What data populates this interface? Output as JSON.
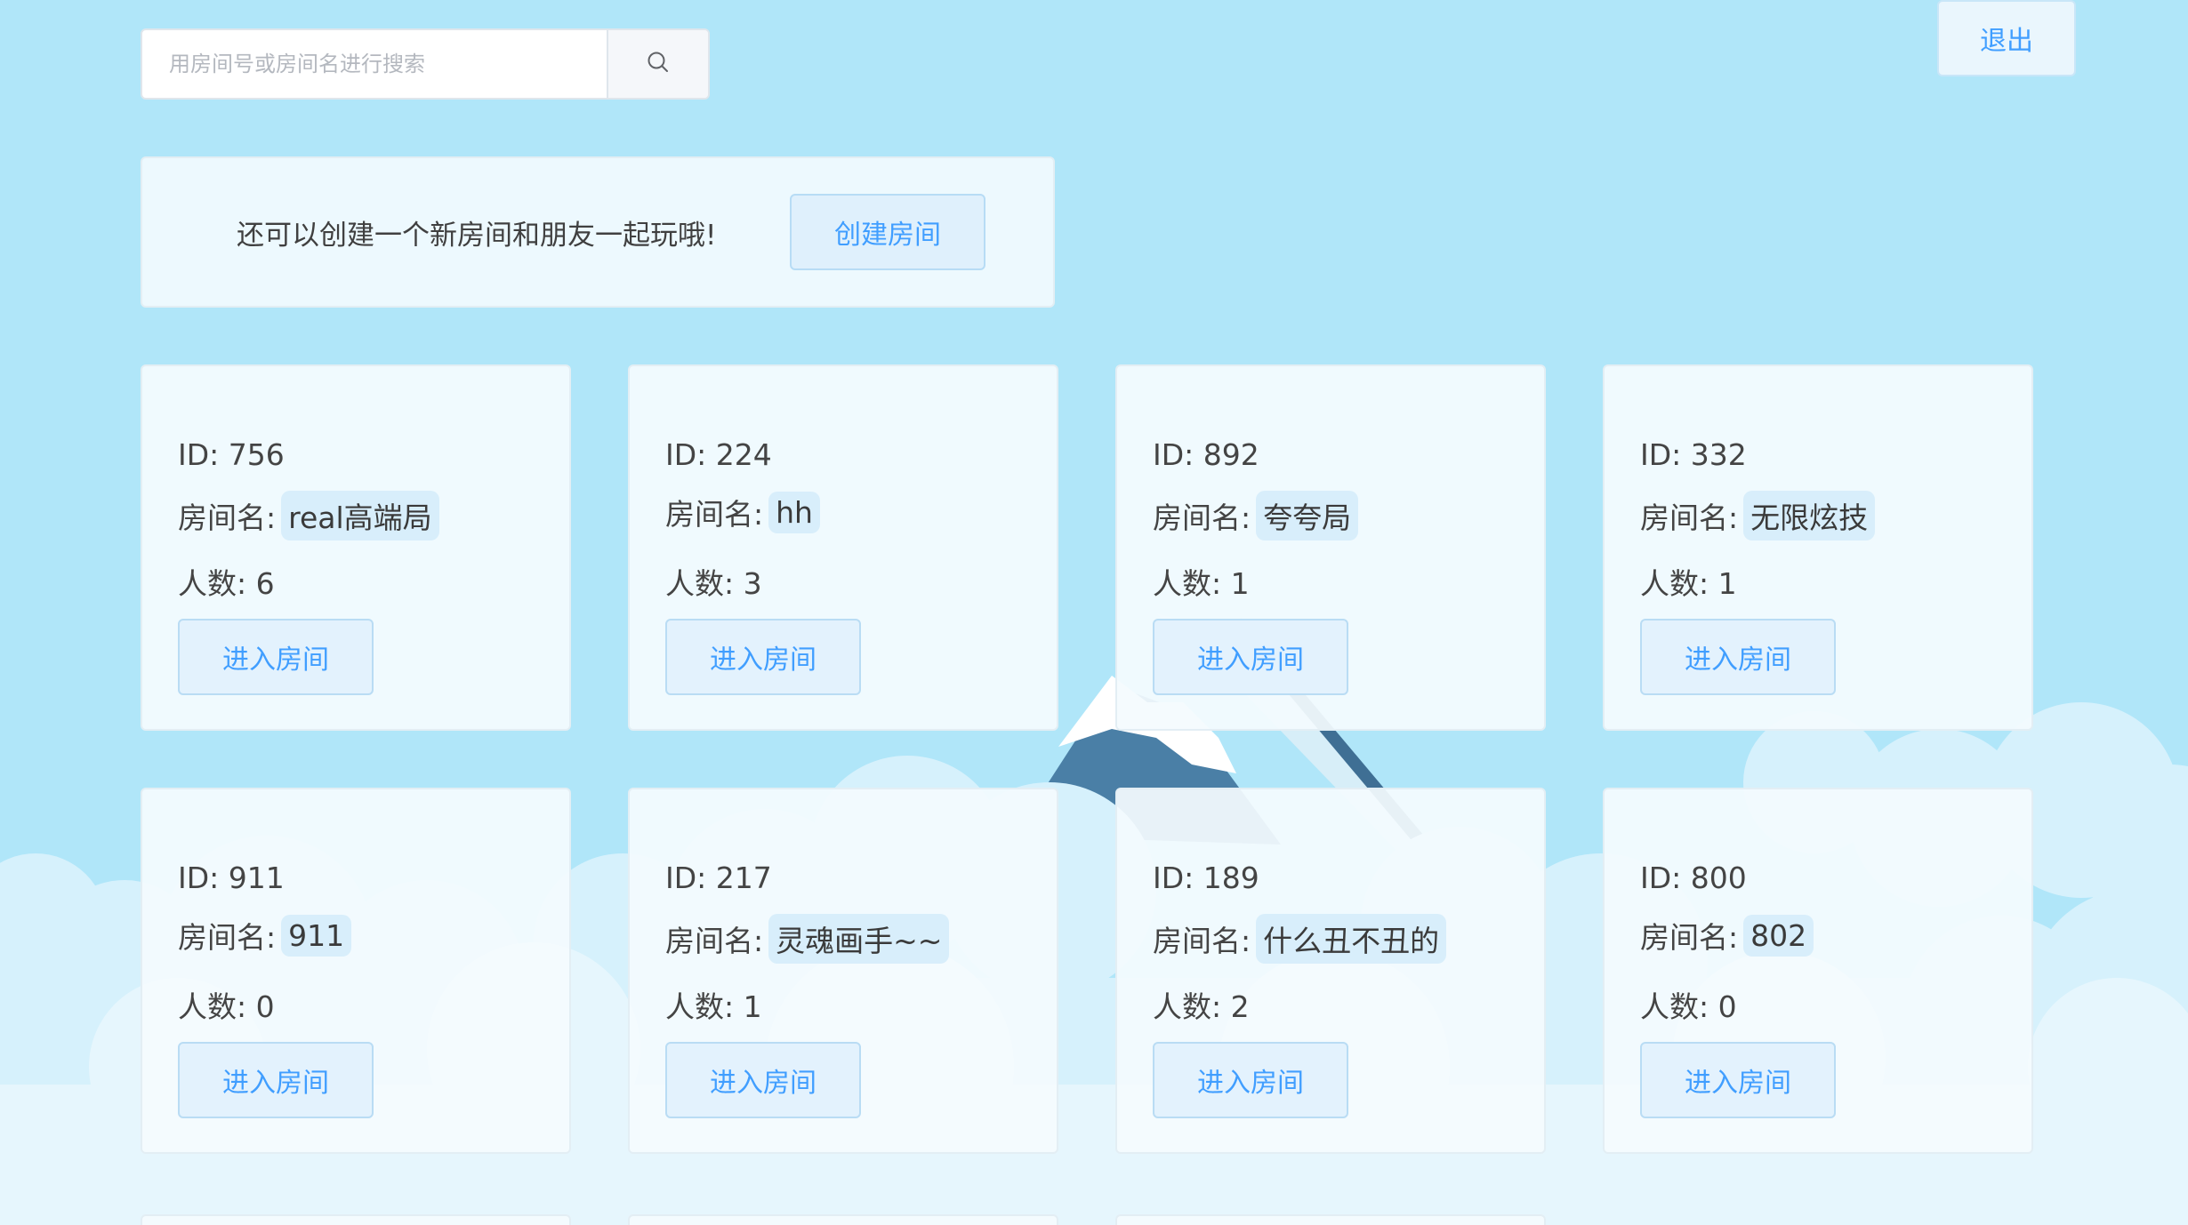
{
  "search": {
    "placeholder": "用房间号或房间名进行搜索",
    "icon": "search-icon"
  },
  "header": {
    "logout_label": "退出"
  },
  "create": {
    "prompt": "还可以创建一个新房间和朋友一起玩哦!",
    "button_label": "创建房间"
  },
  "rooms": [
    {
      "id_text": "ID: 756",
      "name_label": "房间名:",
      "name": "real高端局",
      "count_text": "人数: 6",
      "enter_label": "进入房间"
    },
    {
      "id_text": "ID: 224",
      "name_label": "房间名:",
      "name": "hh",
      "count_text": "人数: 3",
      "enter_label": "进入房间"
    },
    {
      "id_text": "ID: 892",
      "name_label": "房间名:",
      "name": "夸夸局",
      "count_text": "人数: 1",
      "enter_label": "进入房间"
    },
    {
      "id_text": "ID: 332",
      "name_label": "房间名:",
      "name": "无限炫技",
      "count_text": "人数: 1",
      "enter_label": "进入房间"
    },
    {
      "id_text": "ID: 911",
      "name_label": "房间名:",
      "name": "911",
      "count_text": "人数: 0",
      "enter_label": "进入房间"
    },
    {
      "id_text": "ID: 217",
      "name_label": "房间名:",
      "name": "灵魂画手~~",
      "count_text": "人数: 1",
      "enter_label": "进入房间"
    },
    {
      "id_text": "ID: 189",
      "name_label": "房间名:",
      "name": "什么丑不丑的",
      "count_text": "人数: 2",
      "enter_label": "进入房间"
    },
    {
      "id_text": "ID: 800",
      "name_label": "房间名:",
      "name": "802",
      "count_text": "人数: 0",
      "enter_label": "进入房间"
    }
  ],
  "colors": {
    "background": "#b0e6f9",
    "accent": "#409eff",
    "mountain": "#4a7fa6"
  }
}
